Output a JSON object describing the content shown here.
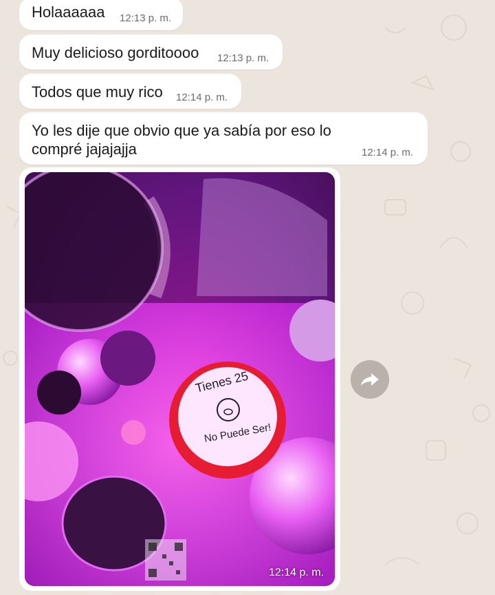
{
  "messages": [
    {
      "text": "Holaaaaaa",
      "time": "12:13 p. m."
    },
    {
      "text": "Muy delicioso gorditoooo",
      "time": "12:13 p. m."
    },
    {
      "text": "Todos que muy rico",
      "time": "12:14 p. m."
    },
    {
      "text": "Yo les dije que obvio que ya sabía por eso lo compré jajajajja",
      "time": "12:14 p. m."
    }
  ],
  "photo_message": {
    "time": "12:14 p. m.",
    "cake_text_top": "Tienes 25",
    "cake_text_bottom": "No Puede Ser!"
  },
  "icons": {
    "forward": "forward-arrow-icon"
  },
  "colors": {
    "bubble": "#ffffff",
    "wallpaper": "#ece5dd",
    "forward_button": "#b9b2aa"
  }
}
